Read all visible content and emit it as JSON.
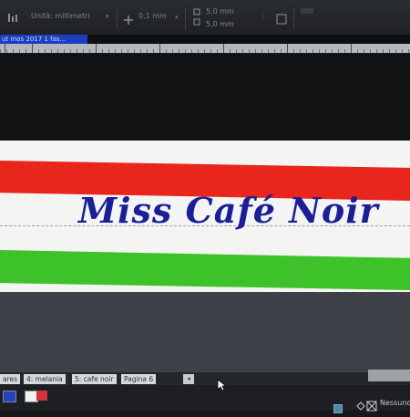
{
  "toolbar": {
    "unit_label": "Unità: millimetri",
    "nudge_value": "0,1 mm",
    "width_value": "5,0 mm",
    "height_value": "5,0 mm"
  },
  "document_tab": "ut mos 2017 1 fas...",
  "artwork": {
    "logo_text": "Miss Café Noir",
    "colors": {
      "red": "#e8261c",
      "green": "#3ec22a",
      "text": "#1a1e9a"
    }
  },
  "page_tabs": [
    "ares",
    "4: melania",
    "5: cafe noir",
    "Pagina 6"
  ],
  "status": {
    "fill_none_label": "Nessuno",
    "stroke_color": "#2443b8",
    "fill_color": "#f2f2f2"
  },
  "icons": [
    "align-icon",
    "move-icon",
    "size-icon",
    "transform-icon",
    "swatch-icon",
    "cursor-icon"
  ]
}
